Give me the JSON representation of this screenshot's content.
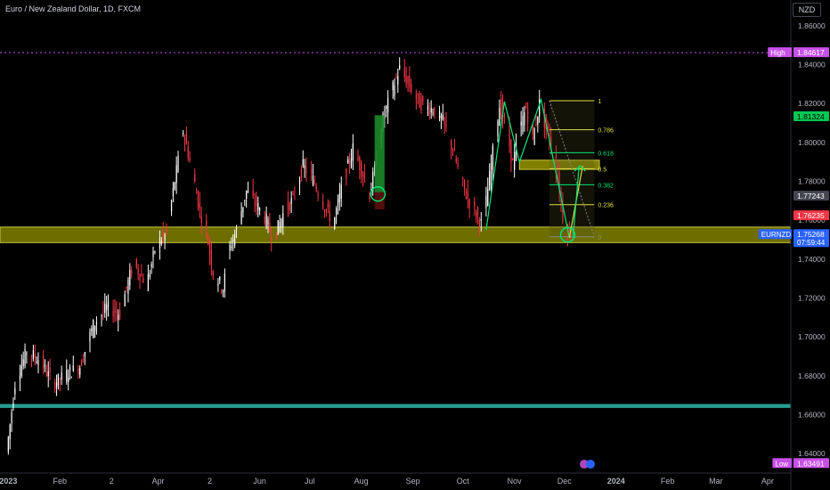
{
  "header": {
    "title": "Euro / New Zealand Dollar, 1D, FXCM",
    "currency": "NZD"
  },
  "colors": {
    "up": "#ffffff",
    "down": "#f23645",
    "zone_yellow": "#808000",
    "zone_teal": "#26a69a",
    "pattern_green": "#00e676",
    "fib_yellow": "#e0e040",
    "high_magenta": "#c850e8",
    "symbol_blue": "#2962ff"
  },
  "chart_data": {
    "type": "candlestick",
    "title": "Euro / New Zealand Dollar, 1D, FXCM",
    "symbol": "EURNZD",
    "ylim": [
      1.63,
      1.865
    ],
    "y_ticks": [
      1.64,
      1.66,
      1.68,
      1.7,
      1.72,
      1.74,
      1.76,
      1.78,
      1.8,
      1.82,
      1.84,
      1.86
    ],
    "y_tick_labels": [
      "1.64000",
      "1.66000",
      "1.68000",
      "1.70000",
      "1.72000",
      "1.74000",
      "1.76000",
      "1.78000",
      "1.80000",
      "1.82000",
      "1.84000",
      "1.86000"
    ],
    "x_labels": [
      "2023",
      "Feb",
      "2",
      "Apr",
      "2",
      "Jun",
      "Jul",
      "Aug",
      "Sep",
      "Oct",
      "Nov",
      "Dec",
      "2024",
      "Feb",
      "Mar",
      "Apr"
    ],
    "x_label_bold": [
      "2023",
      "2024"
    ],
    "x_tick_days": [
      0,
      31,
      62,
      90,
      121,
      151,
      181,
      212,
      243,
      273,
      304,
      334,
      365,
      396,
      425,
      456
    ],
    "x_day_range": [
      -5,
      470
    ],
    "last_day": 338,
    "price_path": [
      [
        0,
        1.641
      ],
      [
        5,
        1.676
      ],
      [
        12,
        1.693
      ],
      [
        20,
        1.688
      ],
      [
        28,
        1.676
      ],
      [
        36,
        1.681
      ],
      [
        44,
        1.685
      ],
      [
        52,
        1.706
      ],
      [
        60,
        1.715
      ],
      [
        68,
        1.712
      ],
      [
        76,
        1.738
      ],
      [
        84,
        1.727
      ],
      [
        90,
        1.748
      ],
      [
        96,
        1.753
      ],
      [
        100,
        1.775
      ],
      [
        106,
        1.806
      ],
      [
        112,
        1.783
      ],
      [
        116,
        1.765
      ],
      [
        120,
        1.754
      ],
      [
        124,
        1.733
      ],
      [
        130,
        1.725
      ],
      [
        134,
        1.746
      ],
      [
        138,
        1.755
      ],
      [
        144,
        1.775
      ],
      [
        150,
        1.768
      ],
      [
        156,
        1.76
      ],
      [
        160,
        1.75
      ],
      [
        166,
        1.763
      ],
      [
        172,
        1.771
      ],
      [
        178,
        1.788
      ],
      [
        184,
        1.781
      ],
      [
        190,
        1.769
      ],
      [
        196,
        1.758
      ],
      [
        202,
        1.779
      ],
      [
        208,
        1.797
      ],
      [
        214,
        1.784
      ],
      [
        218,
        1.773
      ],
      [
        222,
        1.791
      ],
      [
        226,
        1.812
      ],
      [
        232,
        1.828
      ],
      [
        236,
        1.838
      ],
      [
        242,
        1.829
      ],
      [
        248,
        1.82
      ],
      [
        256,
        1.817
      ],
      [
        262,
        1.811
      ],
      [
        268,
        1.796
      ],
      [
        272,
        1.783
      ],
      [
        276,
        1.773
      ],
      [
        282,
        1.763
      ],
      [
        286,
        1.757
      ],
      [
        292,
        1.795
      ],
      [
        296,
        1.819
      ],
      [
        300,
        1.808
      ],
      [
        304,
        1.789
      ],
      [
        308,
        1.806
      ],
      [
        312,
        1.818
      ],
      [
        316,
        1.802
      ],
      [
        320,
        1.82
      ],
      [
        324,
        1.807
      ],
      [
        328,
        1.797
      ],
      [
        332,
        1.776
      ],
      [
        334,
        1.762
      ],
      [
        338,
        1.7527
      ]
    ],
    "horizontal_zones": [
      {
        "low": 1.7485,
        "high": 1.7565,
        "color": "#808000"
      },
      {
        "low": 1.6635,
        "high": 1.6655,
        "color": "#26a69a"
      }
    ],
    "resistance_zone": {
      "day_from": 307,
      "day_to": 355,
      "low": 1.7875,
      "high": 1.7895
    },
    "high_line": 1.84617,
    "fib_levels": [
      1,
      0.786,
      0.618,
      0.5,
      0.382,
      0.236,
      0
    ],
    "fib_labels": [
      "1",
      "0.786",
      "0.618",
      "0.5",
      "0.382",
      "0.236",
      "0"
    ],
    "fib_range": {
      "high": 1.8215,
      "low": 1.7515,
      "day_from": 325,
      "day_to": 352
    },
    "pattern_points": [
      [
        287,
        1.755
      ],
      [
        298,
        1.821
      ],
      [
        307,
        1.79
      ],
      [
        320,
        1.822
      ],
      [
        337,
        1.751
      ]
    ],
    "projection_points": [
      [
        337,
        1.751
      ],
      [
        345,
        1.788
      ]
    ],
    "green_box": {
      "day_from": 220,
      "day_to": 226,
      "low": 1.774,
      "high": 1.814
    },
    "red_box": {
      "day_from": 220,
      "day_to": 226,
      "low": 1.7655,
      "high": 1.7745
    },
    "circle_marks": [
      [
        222,
        1.7735
      ],
      [
        336,
        1.7525
      ]
    ],
    "price_labels": [
      {
        "value": 1.84617,
        "text": "1.84617",
        "tag": "High",
        "color": "#c850e8",
        "text_color": "#ffffff"
      },
      {
        "value": 1.81324,
        "text": "1.81324",
        "tag": "",
        "color": "#00c853",
        "text_color": "#000000"
      },
      {
        "value": 1.77243,
        "text": "1.77243",
        "tag": "",
        "color": "#434651",
        "text_color": "#ffffff"
      },
      {
        "value": 1.76235,
        "text": "1.76235",
        "tag": "",
        "color": "#f23645",
        "text_color": "#ffffff"
      },
      {
        "value": 1.75268,
        "text": "1.75268",
        "tag": "EURNZD",
        "color": "#2962ff",
        "text_color": "#ffffff",
        "sub": "07:59:44"
      },
      {
        "value": 1.63491,
        "text": "1.63491",
        "tag": "Low",
        "color": "#c850e8",
        "text_color": "#ffffff"
      }
    ]
  }
}
